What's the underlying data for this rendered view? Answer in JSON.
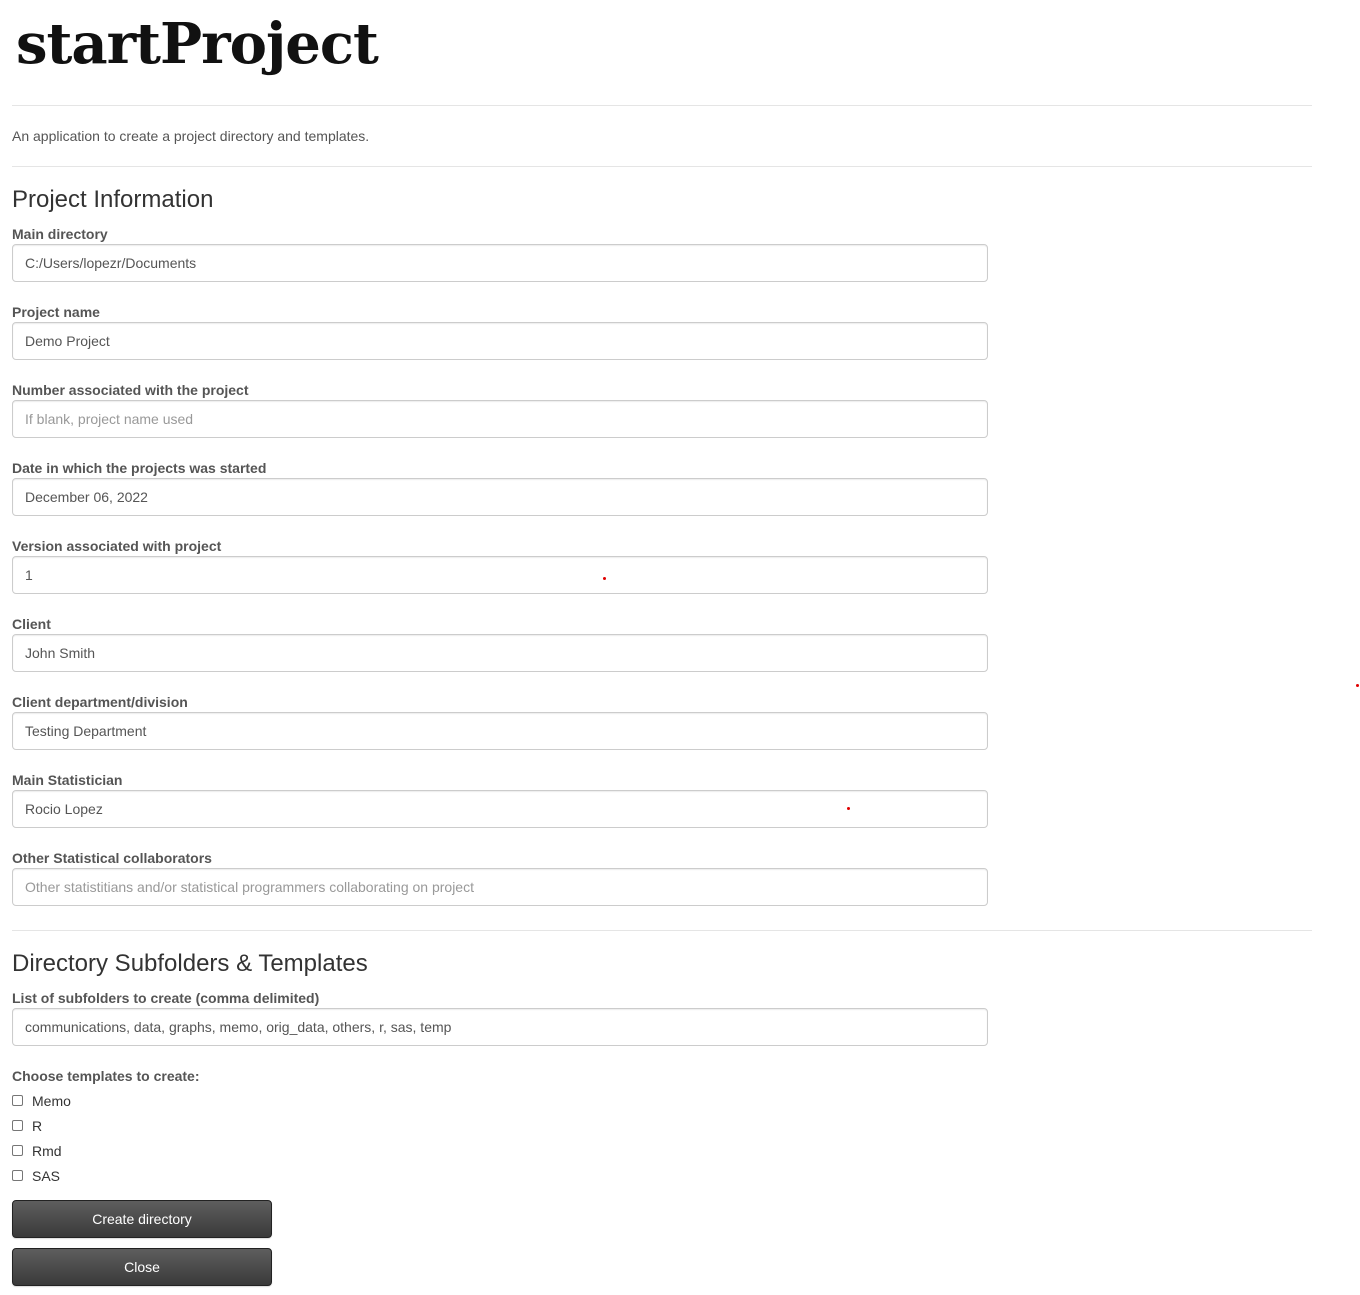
{
  "app": {
    "title": "startProject",
    "description": "An application to create a project directory and templates."
  },
  "project_info": {
    "heading": "Project Information",
    "fields": [
      {
        "label": "Main directory",
        "value": "C:/Users/lopezr/Documents",
        "placeholder": ""
      },
      {
        "label": "Project name",
        "value": "Demo Project",
        "placeholder": ""
      },
      {
        "label": "Number associated with the project",
        "value": "",
        "placeholder": "If blank, project name used"
      },
      {
        "label": "Date in which the projects was started",
        "value": "December 06, 2022",
        "placeholder": ""
      },
      {
        "label": "Version associated with project",
        "value": "1",
        "placeholder": ""
      },
      {
        "label": "Client",
        "value": "John Smith",
        "placeholder": ""
      },
      {
        "label": "Client department/division",
        "value": "Testing Department",
        "placeholder": ""
      },
      {
        "label": "Main Statistician",
        "value": "Rocio Lopez",
        "placeholder": ""
      },
      {
        "label": "Other Statistical collaborators",
        "value": "",
        "placeholder": "Other statistitians and/or statistical programmers collaborating on project"
      }
    ]
  },
  "directory": {
    "heading": "Directory Subfolders & Templates",
    "subfolders": {
      "label": "List of subfolders to create (comma delimited)",
      "value": "communications, data, graphs, memo, orig_data, others, r, sas, temp"
    },
    "templates": {
      "label": "Choose templates to create:",
      "options": [
        {
          "label": "Memo",
          "checked": false
        },
        {
          "label": "R",
          "checked": false
        },
        {
          "label": "Rmd",
          "checked": false
        },
        {
          "label": "SAS",
          "checked": false
        }
      ]
    }
  },
  "buttons": {
    "create": "Create directory",
    "close": "Close"
  },
  "colors": {
    "button_bg": "#474747",
    "text": "#333333",
    "label": "#555555",
    "border": "#cccccc"
  }
}
